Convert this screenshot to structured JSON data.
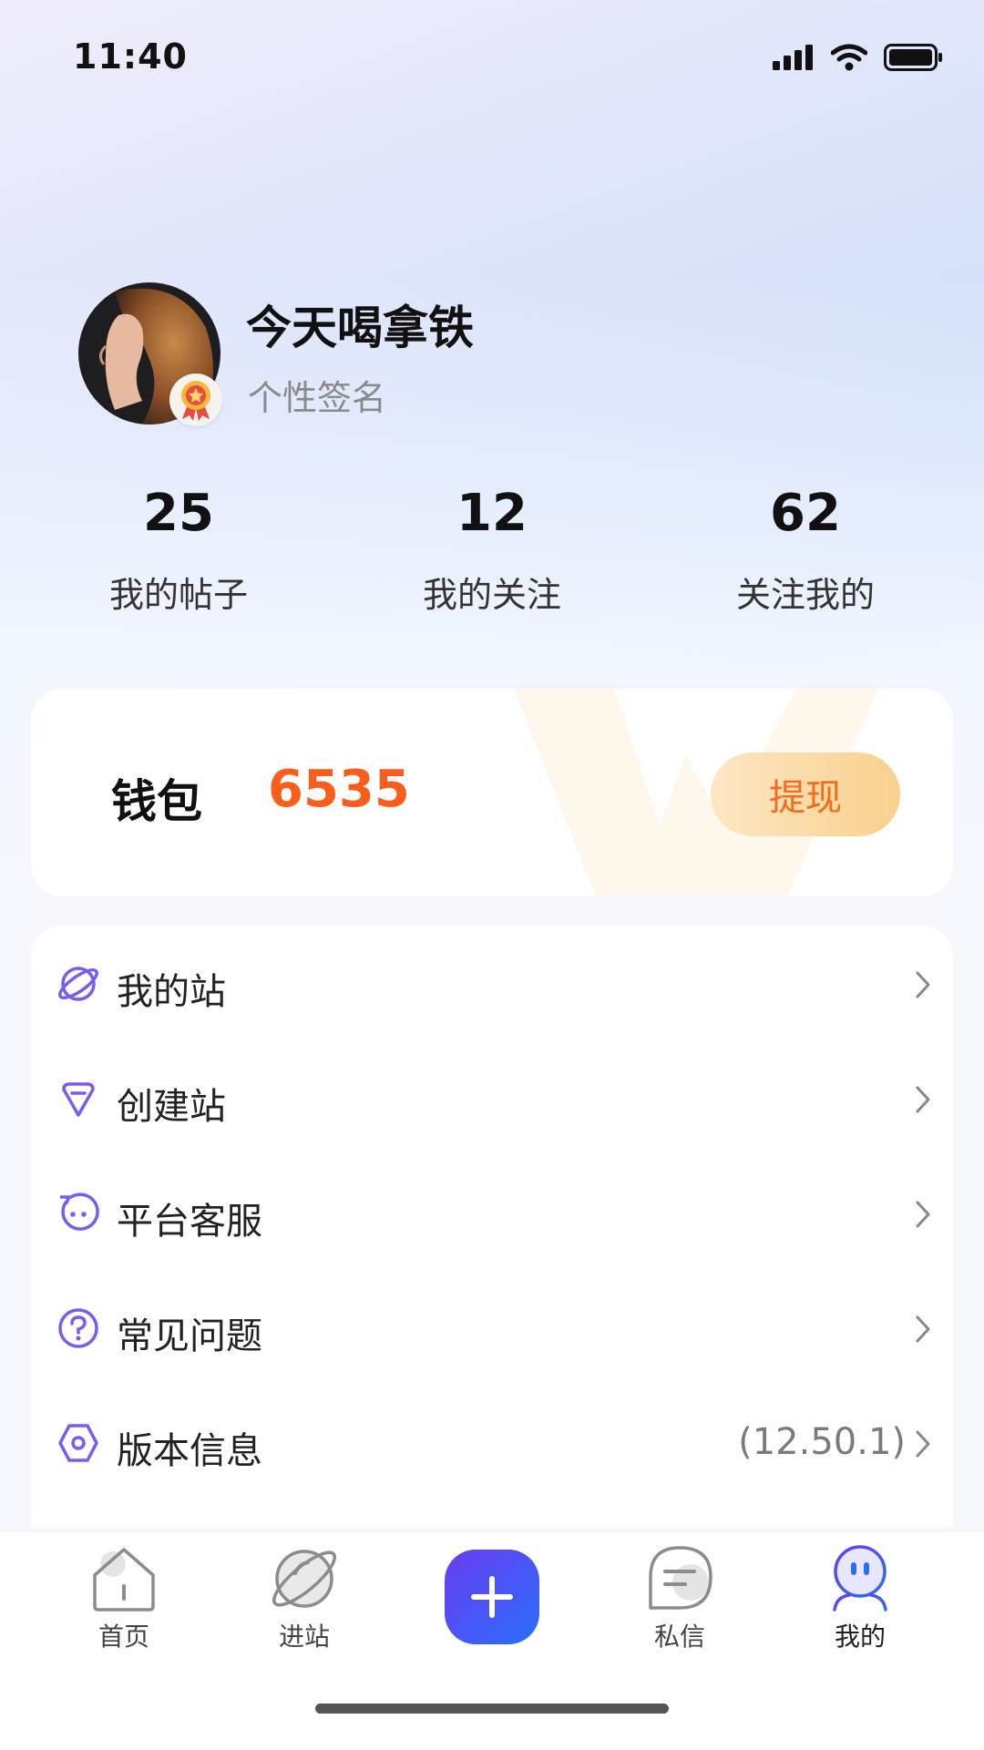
{
  "status_bar": {
    "time": "11:40"
  },
  "profile": {
    "username": "今天喝拿铁",
    "signature": "个性签名"
  },
  "stats": [
    {
      "value": "25",
      "label": "我的帖子"
    },
    {
      "value": "12",
      "label": "我的关注"
    },
    {
      "value": "62",
      "label": "关注我的"
    }
  ],
  "wallet": {
    "label": "钱包",
    "amount": "6535",
    "withdraw_label": "提现"
  },
  "menu": [
    {
      "label": "我的站",
      "icon": "planet-icon"
    },
    {
      "label": "创建站",
      "icon": "diamond-icon"
    },
    {
      "label": "平台客服",
      "icon": "service-bot-icon"
    },
    {
      "label": "常见问题",
      "icon": "question-icon"
    },
    {
      "label": "版本信息",
      "icon": "hexagon-icon",
      "value": "(12.50.1)"
    }
  ],
  "tabbar": {
    "items": [
      {
        "label": "首页",
        "icon": "home-icon"
      },
      {
        "label": "进站",
        "icon": "planet-icon"
      },
      {
        "label": "",
        "icon": "plus-icon"
      },
      {
        "label": "私信",
        "icon": "message-icon"
      },
      {
        "label": "我的",
        "icon": "profile-robot-icon",
        "active": true
      }
    ]
  },
  "colors": {
    "accent_orange": "#fb5e1c",
    "purple": "#7b5cf0",
    "fab_start": "#6a3df2",
    "fab_end": "#2a6dfa"
  }
}
